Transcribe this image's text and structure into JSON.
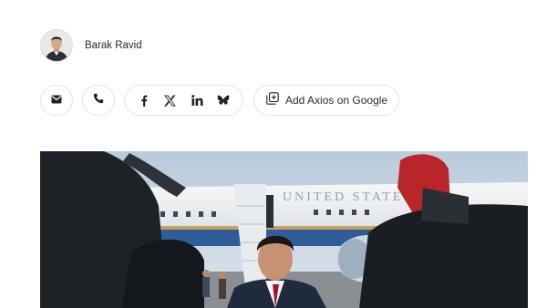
{
  "author": {
    "name": "Barak Ravid",
    "avatar_icon": "author-avatar"
  },
  "share": {
    "email_icon": "envelope-icon",
    "phone_icon": "phone-icon",
    "social": [
      "facebook-icon",
      "x-icon",
      "linkedin-icon",
      "bluesky-icon"
    ],
    "google_label": "Add Axios on Google"
  },
  "hero": {
    "plane_text": "UNITED STATES OF"
  },
  "colors": {
    "border": "#e2e2e2",
    "text": "#2a2a2a",
    "sky": "#c9d6e3",
    "fuselage": "#f1f3f5",
    "stripe": "#2f5d9a"
  }
}
